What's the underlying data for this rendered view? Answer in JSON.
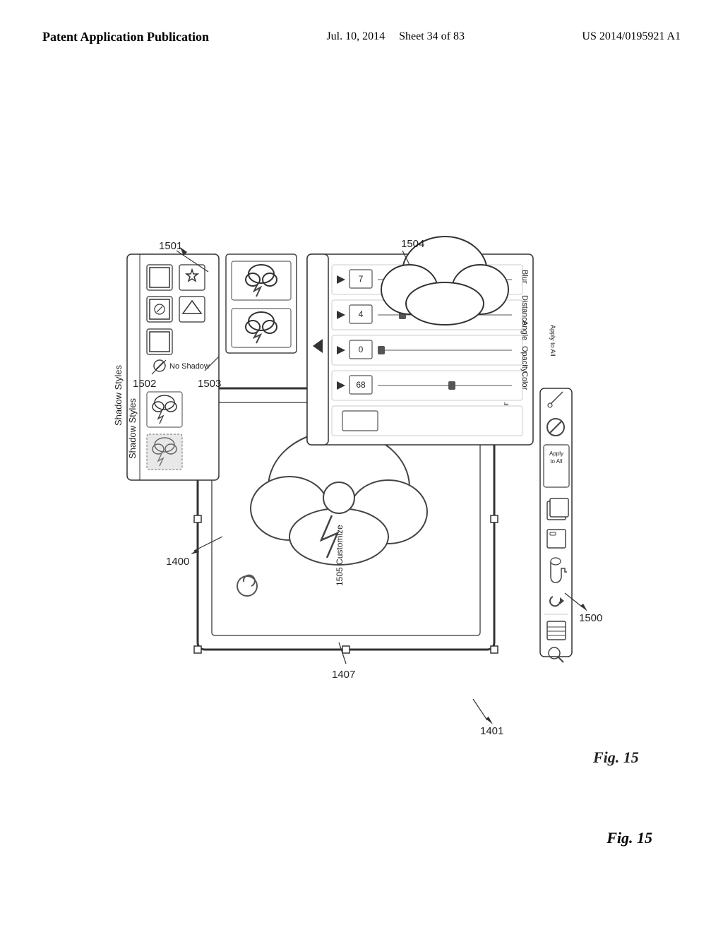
{
  "header": {
    "left": "Patent Application Publication",
    "center_line1": "Jul. 10, 2014",
    "center_line2": "Sheet 34 of 83",
    "right": "US 2014/0195921 A1"
  },
  "figure": {
    "label": "Fig. 15",
    "callouts": {
      "c1501": "1501",
      "c1502": "1502",
      "c1503": "1503",
      "c1504": "1504",
      "c1505": "1505 Customize",
      "c1400": "1400",
      "c1401": "1401",
      "c1407": "1407",
      "c1500": "1500"
    },
    "ui_labels": {
      "shadow_styles": "Shadow Styles",
      "no_shadow": "No Shadow",
      "blur": "Blur",
      "distance": "Distance",
      "angle": "Angle",
      "opacity": "Opacity",
      "color": "Color",
      "apply_to_all": "Apply to All",
      "blur_val": "7",
      "distance_val": "4",
      "angle_val": "0",
      "opacity_val": "68"
    }
  }
}
